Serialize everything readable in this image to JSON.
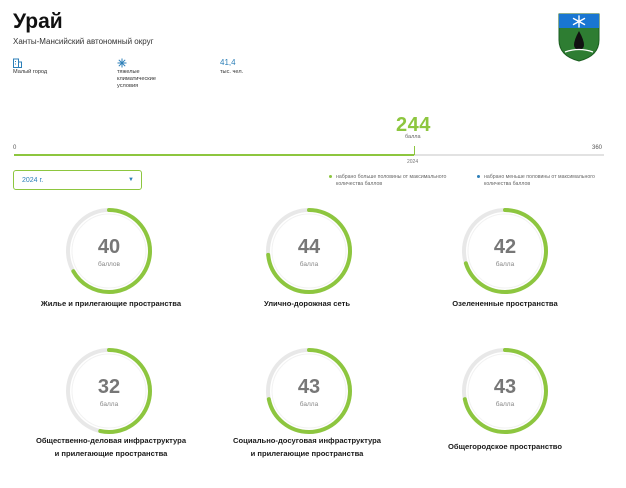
{
  "header": {
    "title": "Урай",
    "subtitle": "Ханты-Мансийский автономный округ"
  },
  "facts": [
    {
      "icon": "building-icon",
      "text": "Малый город"
    },
    {
      "icon": "snowflake-icon",
      "text": "тяжелые климатические условия"
    },
    {
      "value": "41,4",
      "text": "тыс. чел."
    }
  ],
  "score": {
    "value": 244,
    "unit": "балла",
    "min_label": "0",
    "max_label": "360",
    "max": 360,
    "year_label": "2024"
  },
  "year_select": {
    "value": "2024 г."
  },
  "legend": {
    "above": "набрано больше половины от максимального количества баллов",
    "below": "набрано меньше половины от максимального количества баллов"
  },
  "colors": {
    "accent_green": "#8dc63f",
    "accent_blue": "#2c7fb8",
    "ring_track": "#e8e8e8"
  },
  "cards": [
    {
      "value": 40,
      "max": 60,
      "unit": "баллов",
      "label": "Жилье и прилегающие пространства"
    },
    {
      "value": 44,
      "max": 60,
      "unit": "балла",
      "label": "Улично-дорожная сеть"
    },
    {
      "value": 42,
      "max": 60,
      "unit": "балла",
      "label": "Озелененные пространства"
    },
    {
      "value": 32,
      "max": 60,
      "unit": "балла",
      "label": "Общественно-деловая инфраструктура и прилегающие пространства"
    },
    {
      "value": 43,
      "max": 60,
      "unit": "балла",
      "label": "Социально-досуговая инфраструктура и прилегающие пространства"
    },
    {
      "value": 43,
      "max": 60,
      "unit": "балла",
      "label": "Общегородское пространство"
    }
  ]
}
